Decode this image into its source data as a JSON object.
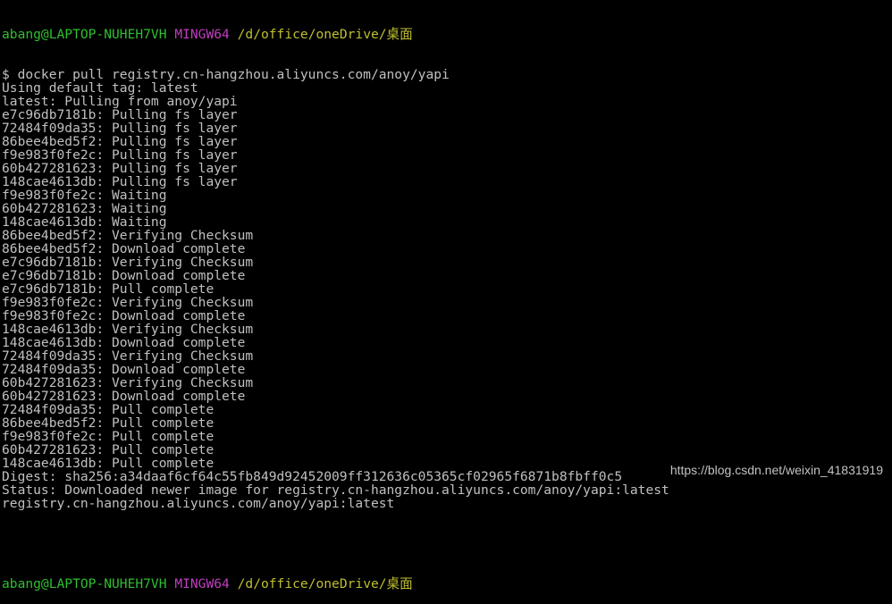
{
  "prompt": {
    "user_host": "abang@LAPTOP-NUHEH7VH",
    "shell": "MINGW64",
    "path": "/d/office/oneDrive/桌面"
  },
  "output_lines": [
    "$ docker pull registry.cn-hangzhou.aliyuncs.com/anoy/yapi",
    "Using default tag: latest",
    "latest: Pulling from anoy/yapi",
    "e7c96db7181b: Pulling fs layer",
    "72484f09da35: Pulling fs layer",
    "86bee4bed5f2: Pulling fs layer",
    "f9e983f0fe2c: Pulling fs layer",
    "60b427281623: Pulling fs layer",
    "148cae4613db: Pulling fs layer",
    "f9e983f0fe2c: Waiting",
    "60b427281623: Waiting",
    "148cae4613db: Waiting",
    "86bee4bed5f2: Verifying Checksum",
    "86bee4bed5f2: Download complete",
    "e7c96db7181b: Verifying Checksum",
    "e7c96db7181b: Download complete",
    "e7c96db7181b: Pull complete",
    "f9e983f0fe2c: Verifying Checksum",
    "f9e983f0fe2c: Download complete",
    "148cae4613db: Verifying Checksum",
    "148cae4613db: Download complete",
    "72484f09da35: Verifying Checksum",
    "72484f09da35: Download complete",
    "60b427281623: Verifying Checksum",
    "60b427281623: Download complete",
    "72484f09da35: Pull complete",
    "86bee4bed5f2: Pull complete",
    "f9e983f0fe2c: Pull complete",
    "60b427281623: Pull complete",
    "148cae4613db: Pull complete",
    "Digest: sha256:a34daaf6cf64c55fb849d92452009ff312636c05365cf02965f6871b8fbff0c5",
    "Status: Downloaded newer image for registry.cn-hangzhou.aliyuncs.com/anoy/yapi:latest",
    "registry.cn-hangzhou.aliyuncs.com/anoy/yapi:latest"
  ],
  "watermark": "https://blog.csdn.net/weixin_41831919",
  "colors": {
    "background": "#000000",
    "text": "#c0c0c0",
    "prompt_user": "#2fbf2f",
    "prompt_host": "#bf3fbf",
    "prompt_path": "#bfbf2f"
  }
}
